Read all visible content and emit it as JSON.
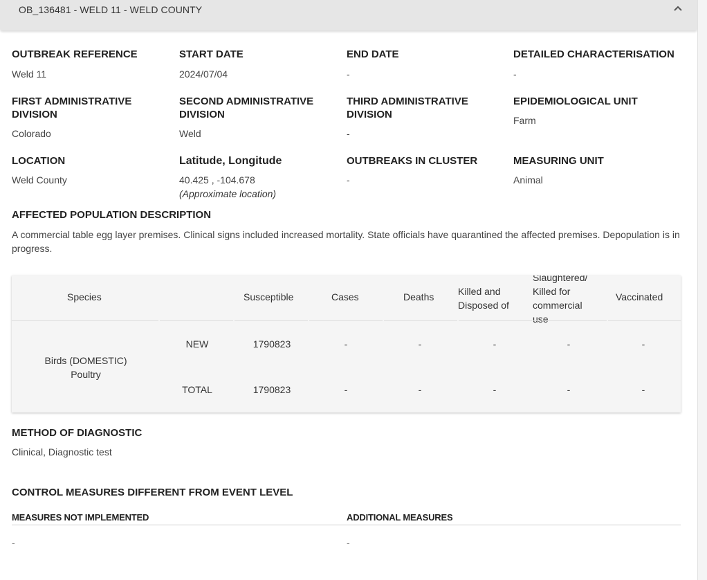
{
  "header": {
    "title": "OB_136481 - WELD 11 - WELD COUNTY"
  },
  "fields": {
    "outbreak_reference": {
      "label": "OUTBREAK REFERENCE",
      "value": "Weld 11"
    },
    "start_date": {
      "label": "START DATE",
      "value": "2024/07/04"
    },
    "end_date": {
      "label": "END DATE",
      "value": "-"
    },
    "detailed_characterisation": {
      "label": "DETAILED CHARACTERISATION",
      "value": "-"
    },
    "first_admin_division": {
      "label_line1": "FIRST ADMINISTRATIVE",
      "label_line2": "DIVISION",
      "value": "Colorado"
    },
    "second_admin_division": {
      "label_line1": "SECOND ADMINISTRATIVE",
      "label_line2": "DIVISION",
      "value": "Weld"
    },
    "third_admin_division": {
      "label_line1": "THIRD ADMINISTRATIVE",
      "label_line2": "DIVISION",
      "value": "-"
    },
    "epidemiological_unit": {
      "label": "EPIDEMIOLOGICAL UNIT",
      "value": "Farm"
    },
    "location": {
      "label": "LOCATION",
      "value": "Weld County"
    },
    "lat_long": {
      "label": "Latitude, Longitude",
      "value": "40.425 , -104.678",
      "note": "(Approximate location)"
    },
    "outbreaks_in_cluster": {
      "label": "OUTBREAKS IN CLUSTER",
      "value": "-"
    },
    "measuring_unit": {
      "label": "MEASURING UNIT",
      "value": "Animal"
    }
  },
  "affected_population": {
    "label": "AFFECTED POPULATION DESCRIPTION",
    "text": "A commercial table egg layer premises. Clinical signs included increased mortality. State officials have quarantined the affected premises. Depopulation is in progress."
  },
  "table": {
    "headers": {
      "species": "Species",
      "susceptible": "Susceptible",
      "cases": "Cases",
      "deaths": "Deaths",
      "killed_1": "Killed and",
      "killed_2": "Disposed of",
      "slaughtered_1": "Slaughtered/",
      "slaughtered_2": "Killed for",
      "slaughtered_3": "commercial",
      "slaughtered_4": "use",
      "vaccinated": "Vaccinated"
    },
    "species_line1": "Birds (DOMESTIC)",
    "species_line2": "Poultry",
    "rows": [
      {
        "type": "NEW",
        "susceptible": "1790823",
        "cases": "-",
        "deaths": "-",
        "killed": "-",
        "slaughtered": "-",
        "vaccinated": "-"
      },
      {
        "type": "TOTAL",
        "susceptible": "1790823",
        "cases": "-",
        "deaths": "-",
        "killed": "-",
        "slaughtered": "-",
        "vaccinated": "-"
      }
    ]
  },
  "diagnostic": {
    "label": "METHOD OF DIAGNOSTIC",
    "value": "Clinical, Diagnostic test"
  },
  "control_measures": {
    "label": "CONTROL MEASURES DIFFERENT FROM EVENT LEVEL",
    "not_implemented": {
      "label": "MEASURES NOT IMPLEMENTED",
      "value": "-"
    },
    "additional": {
      "label": "ADDITIONAL MEASURES",
      "value": "-"
    }
  },
  "icons": {
    "collapse": "chevron-up-icon"
  }
}
